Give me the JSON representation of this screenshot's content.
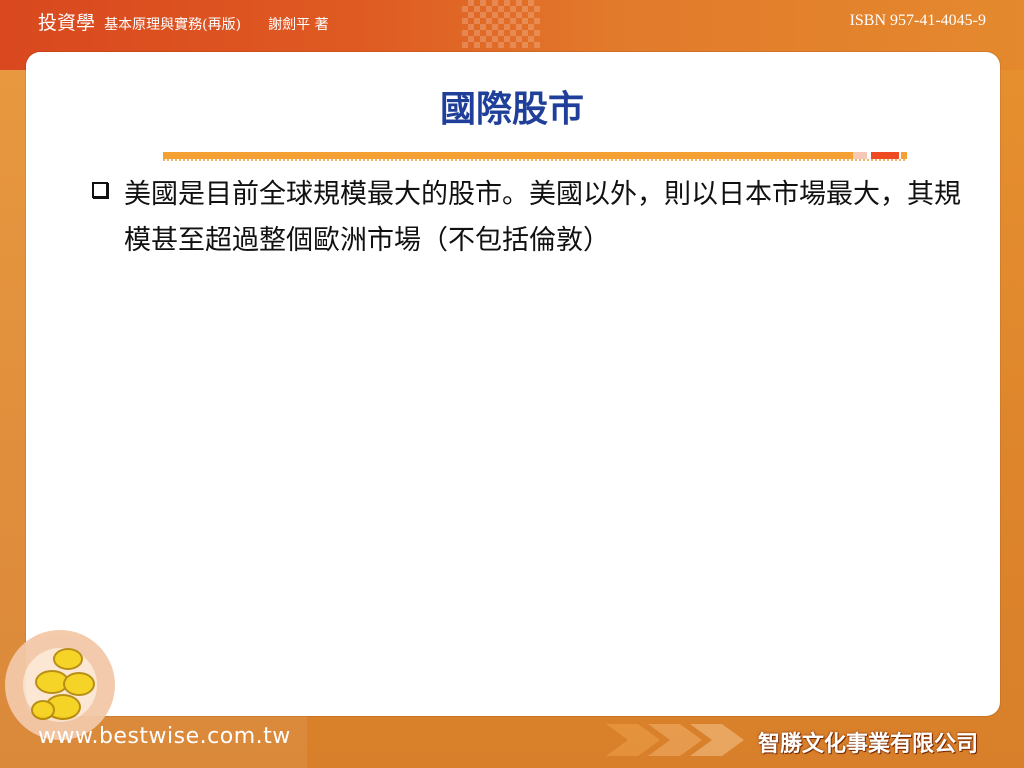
{
  "header": {
    "book_title": "投資學",
    "subtitle": "基本原理與實務(再版)",
    "author": "謝劍平 著",
    "isbn": "ISBN 957-41-4045-9"
  },
  "slide": {
    "title": "國際股市",
    "bullets": [
      {
        "icon": "checkbox-square-icon",
        "text": "美國是目前全球規模最大的股市。美國以外，則以日本市場最大，其規模甚至超過整個歐洲市場（不包括倫敦）"
      }
    ]
  },
  "footer": {
    "url": "www.bestwise.com.tw",
    "publisher": "智勝文化事業有限公司"
  },
  "colors": {
    "background_orange": "#e0892e",
    "header_red": "#d9481f",
    "title_blue": "#1f3f9a",
    "rule_orange": "#f5a033",
    "rule_red": "#ef4b23"
  }
}
